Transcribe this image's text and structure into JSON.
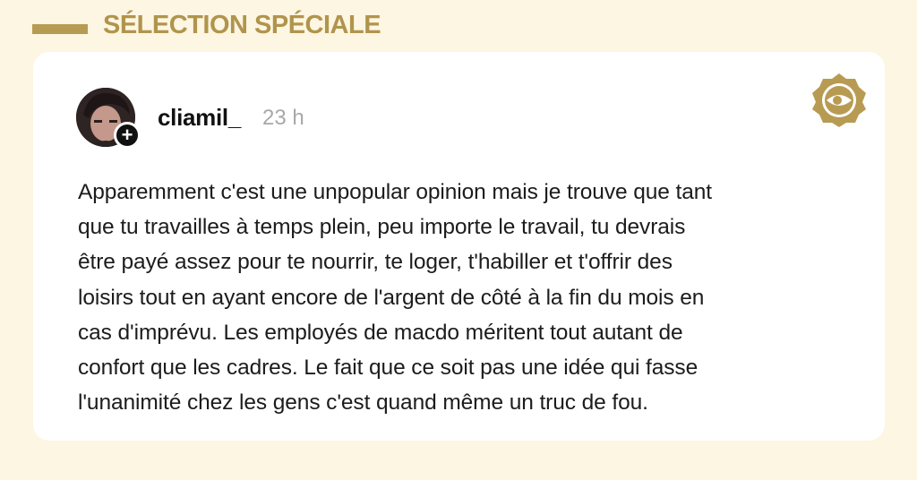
{
  "header": {
    "title": "SÉLECTION SPÉCIALE",
    "accent_color": "#b1944c"
  },
  "post": {
    "username": "cliamil_",
    "timestamp": "23 h",
    "follow_symbol": "+",
    "text": "Apparemment c'est une unpopular opinion mais je trouve que tant\nque tu travailles à temps plein, peu importe le travail, tu devrais\nêtre payé assez pour te nourrir, te loger, t'habiller et t'offrir des\nloisirs tout en ayant encore de l'argent de côté à la fin du mois en\ncas d'imprévu. Les employés de macdo méritent tout autant de\nconfort que les cadres. Le fait que ce soit pas une idée qui fasse\nl'unanimité chez les gens c'est quand même un truc de fou.",
    "icons": {
      "avatar": "profile-avatar",
      "follow": "plus-icon",
      "logo": "brand-badge-icon"
    }
  }
}
